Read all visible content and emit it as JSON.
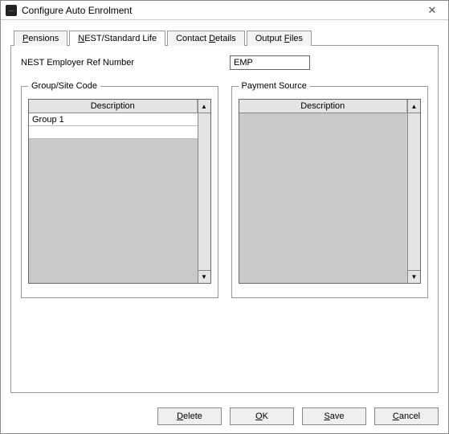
{
  "window": {
    "title": "Configure Auto Enrolment",
    "app_icon_glyph": "...",
    "close_glyph": "✕"
  },
  "tabs": [
    {
      "label": "Pensions",
      "hotkey_index": 0
    },
    {
      "label": "NEST/Standard Life",
      "hotkey_index": 0
    },
    {
      "label": "Contact Details",
      "hotkey_index": 8
    },
    {
      "label": "Output Files",
      "hotkey_index": 7
    }
  ],
  "active_tab": 1,
  "fields": {
    "employer_ref_label": "NEST Employer Ref Number",
    "employer_ref_value": "EMP"
  },
  "group_site": {
    "legend": "Group/Site Code",
    "header": "Description",
    "rows": [
      "Group 1",
      ""
    ]
  },
  "payment_source": {
    "legend": "Payment Source",
    "header": "Description",
    "rows": []
  },
  "buttons": {
    "delete": "Delete",
    "ok": "OK",
    "save": "Save",
    "cancel": "Cancel"
  }
}
